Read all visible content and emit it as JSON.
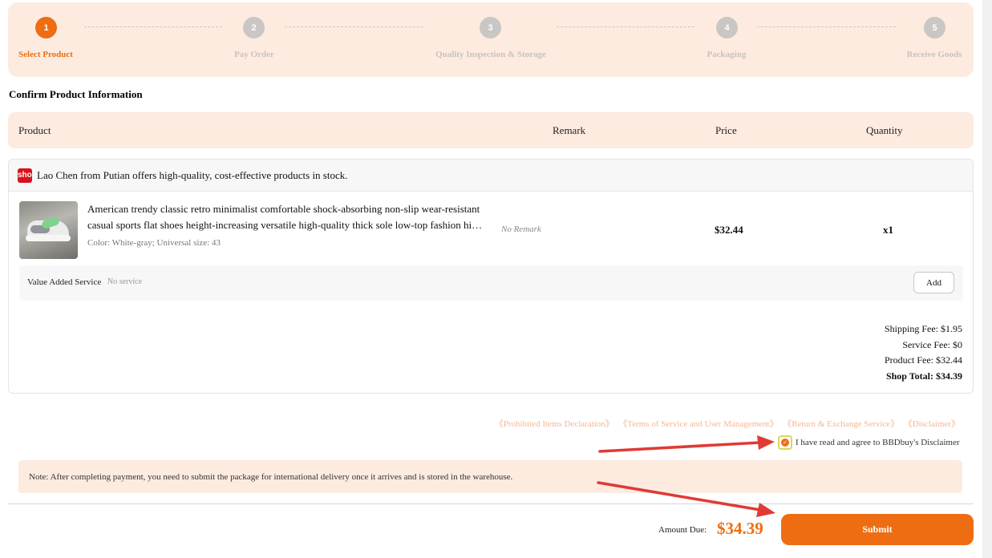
{
  "colors": {
    "accent": "#ee6d12",
    "light_bg": "#fdebe0",
    "annotation_arrow": "#e03a36"
  },
  "stepper": {
    "steps": [
      {
        "number": "1",
        "label": "Select Product",
        "active": true
      },
      {
        "number": "2",
        "label": "Pay Order",
        "active": false
      },
      {
        "number": "3",
        "label": "Quality Inspection & Storage",
        "active": false
      },
      {
        "number": "4",
        "label": "Packaging",
        "active": false
      },
      {
        "number": "5",
        "label": "Receive Goods",
        "active": false
      }
    ]
  },
  "section_title": "Confirm Product Information",
  "table_header": {
    "product": "Product",
    "remark": "Remark",
    "price": "Price",
    "quantity": "Quantity"
  },
  "shop": {
    "badge": "shop",
    "name": "Lao Chen from Putian offers high-quality, cost-effective products in stock.",
    "item": {
      "title_line1": "American trendy classic retro minimalist comfortable shock-absorbing non-slip wear-resistant",
      "title_line2": "casual sports flat shoes height-increasing versatile high-quality thick sole low-top fashion high-quality shoes",
      "attributes": "Color: White-gray; Universal size: 43",
      "remark": "No Remark",
      "price": "$32.44",
      "quantity": "x1"
    },
    "value_added": {
      "label": "Value Added Service",
      "value": "No service",
      "add_label": "Add"
    },
    "fees": {
      "shipping": "Shipping Fee: $1.95",
      "service": "Service Fee: $0",
      "product": "Product Fee: $32.44",
      "total": "Shop Total: $34.39"
    }
  },
  "links": [
    "《Prohibited Items Declaration》",
    "《Terms of Service and User Management》",
    "《Return & Exchange Service》",
    "《Disclaimer》"
  ],
  "agreement": {
    "checked": true,
    "text": "I have read and agree to BBDbuy's Disclaimer"
  },
  "note": "Note: After completing payment, you need to submit the package for international delivery once it arrives and is stored in the warehouse.",
  "footer": {
    "amount_label": "Amount Due:",
    "amount_value": "$34.39",
    "submit_label": "Submit"
  }
}
